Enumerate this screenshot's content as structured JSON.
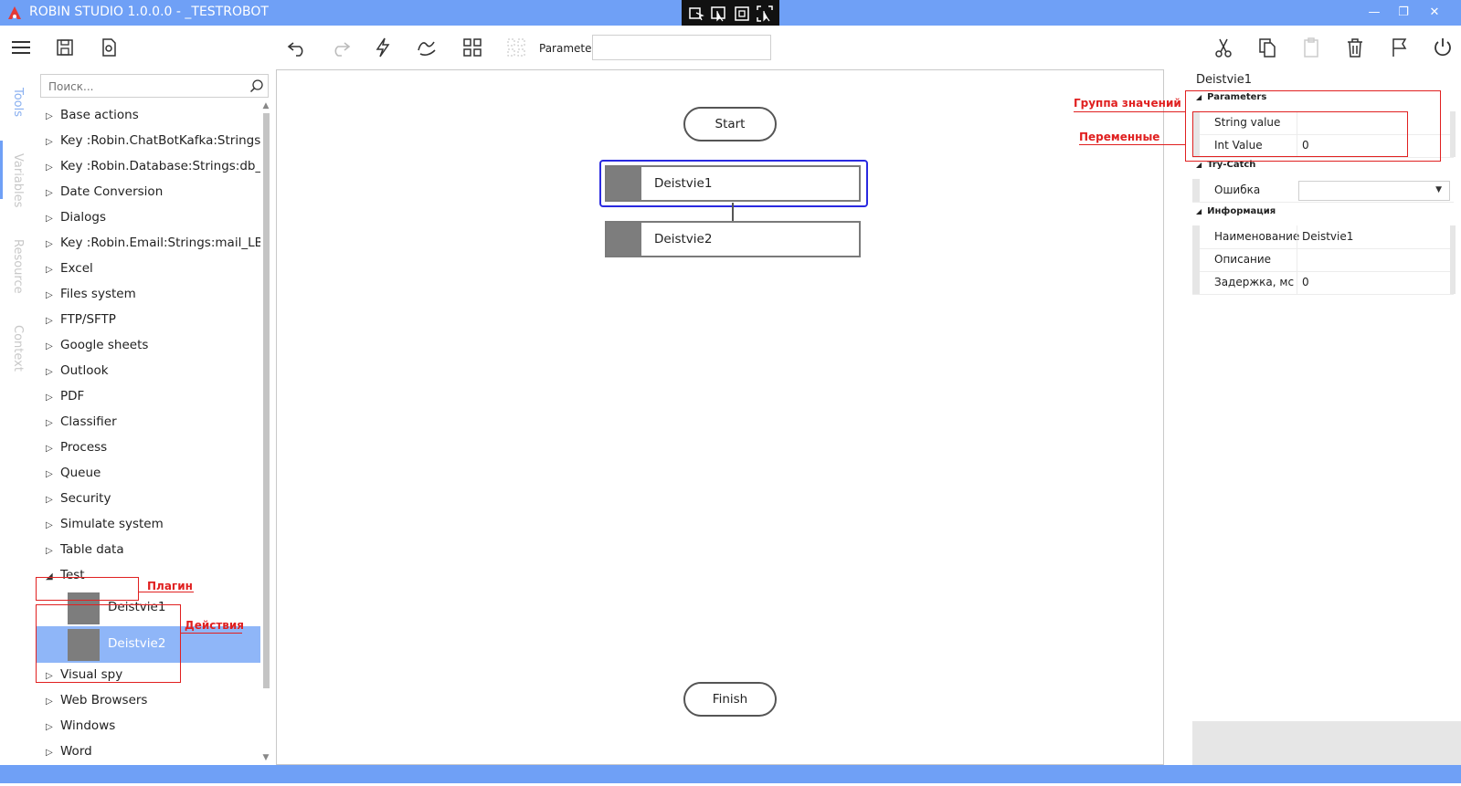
{
  "window": {
    "title": "ROBIN STUDIO 1.0.0.0 - _TESTROBOT",
    "controls": [
      "—",
      "❐",
      "✕"
    ]
  },
  "toolbar": {
    "parameter_label": "Parameter",
    "parameter_value": ""
  },
  "side_tabs": [
    "Tools",
    "Variables",
    "Resource",
    "Context"
  ],
  "tools": {
    "search_placeholder": "Поиск...",
    "categories_before": [
      "Base actions",
      "Key :Robin.ChatBotKafka:Strings:__C",
      "Key :Robin.Database:Strings:db_LB",
      "Date Conversion",
      "Dialogs",
      "Key :Robin.Email:Strings:mail_LB",
      "Excel",
      "Files system",
      "FTP/SFTP",
      "Google sheets",
      "Outlook",
      "PDF",
      "Classifier",
      "Process",
      "Queue",
      "Security",
      "Simulate system",
      "Table data"
    ],
    "expanded_category": "Test",
    "actions": [
      "Deistvie1",
      "Deistvie2"
    ],
    "categories_after": [
      "Visual spy",
      "Web Browsers",
      "Windows",
      "Word"
    ]
  },
  "canvas": {
    "start_label": "Start",
    "finish_label": "Finish",
    "nodes": [
      "Deistvie1",
      "Deistvie2"
    ]
  },
  "annotations": {
    "plugin": "Плагин",
    "actions": "Действия",
    "value_group": "Группа значений",
    "variables": "Переменные"
  },
  "properties": {
    "title": "Deistvie1",
    "groups": {
      "parameters": "Parameters",
      "try_catch": "Try-Catch",
      "info": "Информация"
    },
    "string_value": {
      "name": "String value",
      "value": ""
    },
    "int_value": {
      "name": "Int Value",
      "value": "0"
    },
    "error": {
      "name": "Ошибка",
      "value": ""
    },
    "name_row": {
      "name": "Наименование",
      "value": "Deistvie1"
    },
    "description_row": {
      "name": "Описание",
      "value": ""
    },
    "delay_row": {
      "name": "Задержка, мс",
      "value": "0"
    }
  }
}
